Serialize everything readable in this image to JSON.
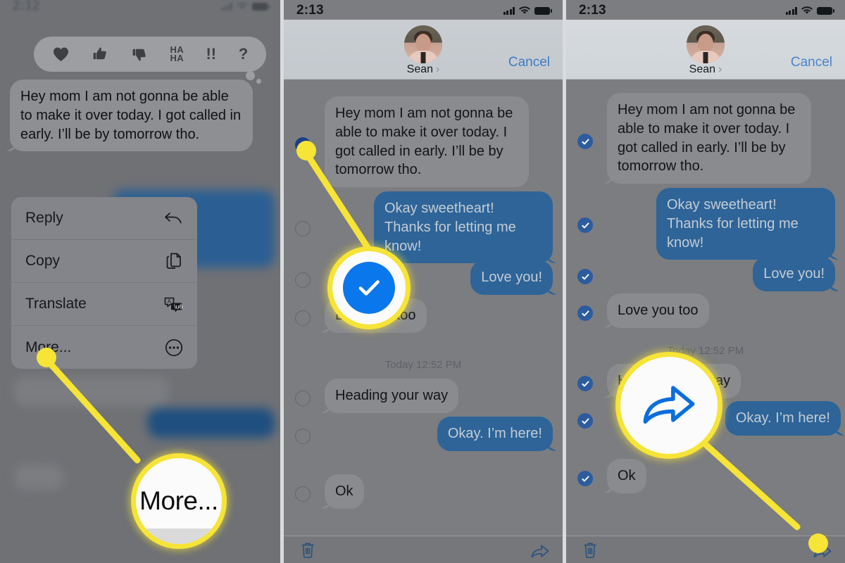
{
  "panels": [
    {
      "id": "panel-1",
      "status": {
        "time": "2:12",
        "signal_icon": "cellular-bars-icon",
        "wifi_icon": "wifi-icon",
        "battery_icon": "battery-icon"
      },
      "tapbacks": [
        {
          "name": "heart-icon",
          "label": "♥"
        },
        {
          "name": "thumbs-up-icon",
          "label": "👍"
        },
        {
          "name": "thumbs-down-icon",
          "label": "👎"
        },
        {
          "name": "haha-icon",
          "label": "HA HA"
        },
        {
          "name": "exclamation-icon",
          "label": "!!"
        },
        {
          "name": "question-icon",
          "label": "?"
        }
      ],
      "message": "Hey mom I am not gonna be able to make it over today. I got called in early. I’ll be by tomorrow tho.",
      "context_menu": [
        {
          "label": "Reply",
          "icon": "reply-arrow-icon"
        },
        {
          "label": "Copy",
          "icon": "copy-pages-icon"
        },
        {
          "label": "Translate",
          "icon": "translate-icon"
        },
        {
          "label": "More...",
          "icon": "ellipsis-circle-icon"
        }
      ],
      "callout": {
        "type": "text",
        "text": "More...",
        "target": "More... menu item"
      }
    },
    {
      "id": "panel-2",
      "status": {
        "time": "2:13",
        "signal_icon": "cellular-bars-icon",
        "wifi_icon": "wifi-icon",
        "battery_icon": "battery-icon"
      },
      "nav": {
        "contact": "Sean",
        "chevron": "›",
        "cancel": "Cancel"
      },
      "messages": [
        {
          "text": "Hey mom I am not gonna be able to make it over today. I got called in early. I’ll be by tomorrow tho.",
          "side": "left",
          "selected": true
        },
        {
          "text": "Okay sweetheart! Thanks for letting me know!",
          "side": "right",
          "selected": false
        },
        {
          "text": "Love you!",
          "side": "right",
          "selected": false
        },
        {
          "text": "Love you too",
          "side": "left",
          "selected": false
        },
        {
          "text": "Heading your way",
          "side": "left",
          "selected": false
        },
        {
          "text": "Okay. I’m here!",
          "side": "right",
          "selected": false
        },
        {
          "text": "Ok",
          "side": "left",
          "selected": false
        }
      ],
      "timestamp": "Today 12:52 PM",
      "toolbar": {
        "delete_icon": "trash-icon",
        "forward_icon": "forward-arrow-icon"
      },
      "callout": {
        "type": "check",
        "icon": "blue-check-circle-icon",
        "target": "message selection checkbox"
      }
    },
    {
      "id": "panel-3",
      "status": {
        "time": "2:13",
        "signal_icon": "cellular-bars-icon",
        "wifi_icon": "wifi-icon",
        "battery_icon": "battery-icon"
      },
      "nav": {
        "contact": "Sean",
        "chevron": "›",
        "cancel": "Cancel"
      },
      "messages": [
        {
          "text": "Hey mom I am not gonna be able to make it over today. I got called in early. I’ll be by tomorrow tho.",
          "side": "left",
          "selected": true
        },
        {
          "text": "Okay sweetheart! Thanks for letting me know!",
          "side": "right",
          "selected": true
        },
        {
          "text": "Love you!",
          "side": "right",
          "selected": true
        },
        {
          "text": "Love you too",
          "side": "left",
          "selected": true
        },
        {
          "text": "Heading your way",
          "side": "left",
          "selected": true
        },
        {
          "text": "Okay. I’m here!",
          "side": "right",
          "selected": true
        },
        {
          "text": "Ok",
          "side": "left",
          "selected": true
        }
      ],
      "timestamp": "Today 12:52 PM",
      "toolbar": {
        "delete_icon": "trash-icon",
        "forward_icon": "forward-arrow-icon"
      },
      "callout": {
        "type": "forward",
        "icon": "forward-arrow-icon",
        "target": "forward button"
      }
    }
  ],
  "colors": {
    "highlight_yellow": "#f6e436",
    "ios_blue": "#0a77ed",
    "bubble_blue": "#2e6498",
    "bubble_gray": "#8a8b8f",
    "link_blue": "#3e7cc4",
    "check_blue": "#2c5c9e"
  }
}
